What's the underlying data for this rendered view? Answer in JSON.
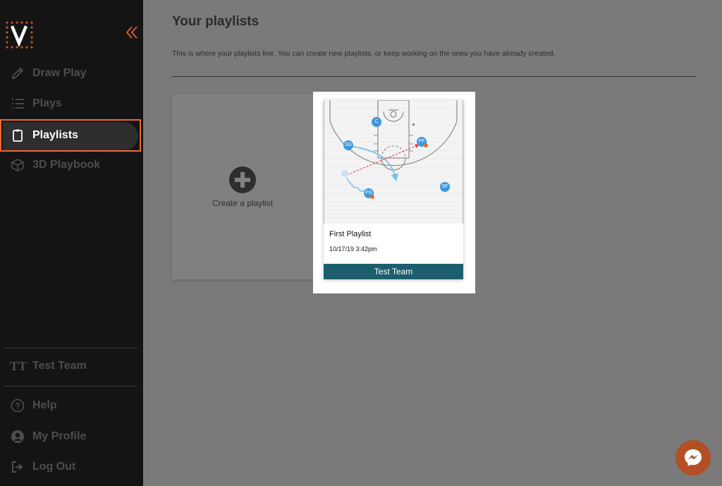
{
  "sidebar": {
    "nav": [
      {
        "label": "Draw Play",
        "icon": "pencil-icon"
      },
      {
        "label": "Plays",
        "icon": "list-icon"
      },
      {
        "label": "Playlists",
        "icon": "clipboard-icon"
      },
      {
        "label": "3D Playbook",
        "icon": "cube-icon"
      }
    ],
    "team": {
      "initials": "TT",
      "name": "Test Team"
    },
    "footer": [
      {
        "label": "Help",
        "icon": "help-icon"
      },
      {
        "label": "My Profile",
        "icon": "user-icon"
      },
      {
        "label": "Log Out",
        "icon": "logout-icon"
      }
    ]
  },
  "main": {
    "title": "Your playlists",
    "description": "This is where your playlists live. You can create new playlists, or keep working on the ones you have already created.",
    "create_label": "Create a playlist",
    "playlists": [
      {
        "title": "First Playlist",
        "date": "10/17/19 3:42pm",
        "team": "Test Team",
        "players": [
          "C",
          "PF",
          "SG",
          "PG",
          "SF"
        ]
      }
    ]
  },
  "colors": {
    "accent": "#ea6a32",
    "team_bar": "#1c5d6e",
    "player": "#3d97e0",
    "sidebar_bg": "#141414"
  }
}
